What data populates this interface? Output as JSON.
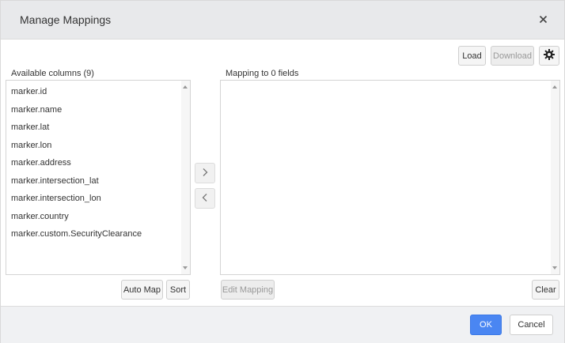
{
  "dialog": {
    "title": "Manage Mappings"
  },
  "toolbar": {
    "load_label": "Load",
    "download_label": "Download"
  },
  "available": {
    "label": "Available columns (9)",
    "items": [
      "marker.id",
      "marker.name",
      "marker.lat",
      "marker.lon",
      "marker.address",
      "marker.intersection_lat",
      "marker.intersection_lon",
      "marker.country",
      "marker.custom.SecurityClearance"
    ],
    "automap_label": "Auto Map",
    "sort_label": "Sort"
  },
  "mapping": {
    "label": "Mapping to 0 fields",
    "edit_label": "Edit Mapping",
    "clear_label": "Clear"
  },
  "footer": {
    "ok_label": "OK",
    "cancel_label": "Cancel"
  },
  "colors": {
    "header_bg": "#e8e9eb",
    "primary": "#4a86f2",
    "footer_bg": "#f0f1f3"
  },
  "icons": {
    "close": "close-icon",
    "settings": "gear-icon",
    "add": "chevron-right-icon",
    "remove": "chevron-left-icon"
  }
}
